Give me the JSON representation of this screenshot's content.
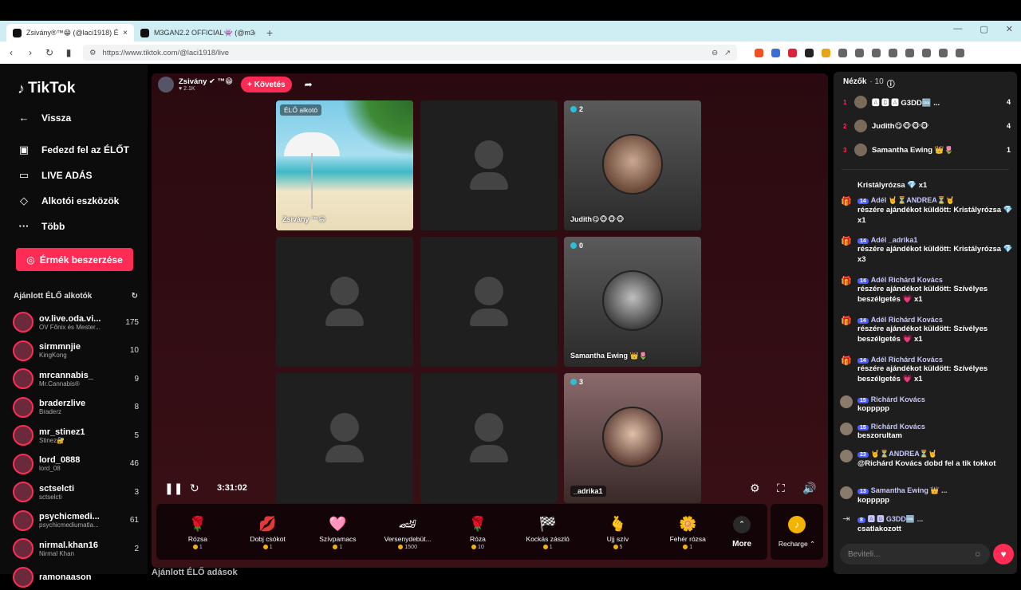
{
  "browser": {
    "tabs": [
      {
        "title": "Zsivány®™😁 (@laci1918) ÉL",
        "close": "×"
      },
      {
        "title": "M3GAN2.2 OFFICIAL👾 (@m3gan"
      }
    ],
    "new_tab": "+",
    "url": "https://www.tiktok.com/@laci1918/live"
  },
  "sidebar": {
    "logo": "TikTok",
    "items": [
      {
        "label": "Vissza",
        "icon": "back-arrow-icon"
      },
      {
        "label": "Fedezd fel az ÉLŐT",
        "icon": "live-explore-icon"
      },
      {
        "label": "LIVE ADÁS",
        "icon": "camera-icon"
      },
      {
        "label": "Alkotói eszközök",
        "icon": "creator-tools-icon"
      },
      {
        "label": "Több",
        "icon": "more-icon"
      }
    ],
    "coin_button": "Érmék beszerzése",
    "recommended_title": "Ajánlott ÉLŐ alkotók",
    "creators": [
      {
        "name": "ov.live.oda.vi...",
        "sub": "OV Főnix és Mester...",
        "count": "175"
      },
      {
        "name": "sirmmnjie",
        "sub": "KingKong",
        "count": "10"
      },
      {
        "name": "mrcannabis_",
        "sub": "Mr.Cannabis®",
        "count": "9"
      },
      {
        "name": "braderzlive",
        "sub": "Braderz",
        "count": "8"
      },
      {
        "name": "mr_stinez1",
        "sub": "Stinez🔐",
        "count": "5"
      },
      {
        "name": "lord_0888",
        "sub": "lord_08",
        "count": "46"
      },
      {
        "name": "sctselcti",
        "sub": "sctselcti",
        "count": "3"
      },
      {
        "name": "psychicmedi...",
        "sub": "psychicmediumatla...",
        "count": "61"
      },
      {
        "name": "nirmal.khan16",
        "sub": "Nirmal Khan",
        "count": "2"
      },
      {
        "name": "ramonaason",
        "sub": "",
        "count": ""
      }
    ]
  },
  "stage": {
    "host_name": "Zsivány",
    "host_suffix": "™😁",
    "host_likes": "♥ 2.1K",
    "follow_label": "+ Követés",
    "tiles": {
      "host_tag": "ÉLŐ alkotó",
      "host_label": "Zsivány ™😁",
      "judith_count": "2",
      "judith_label": "Judith😋🐵🐵🐵",
      "samantha_count": "0",
      "samantha_label": "Samantha Ewing 👑🌷",
      "adrika_count": "3",
      "adrika_label": "_adrika1"
    },
    "time": "3:31:02"
  },
  "gifts": [
    {
      "name": "Rózsa",
      "price": "1",
      "icon": "🌹"
    },
    {
      "name": "Dobj csókot",
      "price": "1",
      "icon": "💋"
    },
    {
      "name": "Szívpamacs",
      "price": "1",
      "icon": "🩷"
    },
    {
      "name": "Versenydebüt...",
      "price": "1500",
      "icon": "🏎"
    },
    {
      "name": "Róza",
      "price": "10",
      "icon": "🌹"
    },
    {
      "name": "Kockás zászló",
      "price": "1",
      "icon": "🏁"
    },
    {
      "name": "Ujj szív",
      "price": "5",
      "icon": "🫰"
    },
    {
      "name": "Fehér rózsa",
      "price": "1",
      "icon": "🌼"
    }
  ],
  "more_label": "More",
  "recharge_label": "Recharge ⌃",
  "bottom_heading": "Ajánlott ÉLŐ adások",
  "right_panel": {
    "viewers_title": "Nézők",
    "viewers_count": "· 10",
    "viewers": [
      {
        "rank": "1",
        "name": "🅰 🅱 🅰 G3DD🆒 ...",
        "score": "4"
      },
      {
        "rank": "2",
        "name": "Judith😋🐵🐵🐵",
        "score": "4"
      },
      {
        "rank": "3",
        "name": "Samantha Ewing 👑🌷",
        "score": "1"
      }
    ],
    "chat": [
      {
        "kind": "gift",
        "user": "",
        "badge": "",
        "msg": "Kristályrózsa 💎 x1"
      },
      {
        "kind": "gift",
        "user": "Adél 🤘⏳ANDREA⏳🤘",
        "badge": "14",
        "msg": "részére ajándékot küldött: Kristályrózsa 💎 x1"
      },
      {
        "kind": "gift",
        "user": "Adél _adrika1",
        "badge": "14",
        "msg": "részére ajándékot küldött: Kristályrózsa 💎 x3"
      },
      {
        "kind": "gift",
        "user": "Adél Richárd Kovács",
        "badge": "14",
        "msg": "részére ajándékot küldött: Szívélyes beszélgetés 💗 x1"
      },
      {
        "kind": "gift",
        "user": "Adél Richárd Kovács",
        "badge": "14",
        "msg": "részére ajándékot küldött: Szívélyes beszélgetés 💗 x1"
      },
      {
        "kind": "gift",
        "user": "Adél Richárd Kovács",
        "badge": "14",
        "msg": "részére ajándékot küldött: Szívélyes beszélgetés 💗 x1"
      },
      {
        "kind": "msg",
        "user": "Richárd Kovács",
        "badge": "15",
        "msg": "koppppp"
      },
      {
        "kind": "msg",
        "user": "Richárd Kovács",
        "badge": "15",
        "msg": "beszorultam"
      },
      {
        "kind": "msg",
        "user": "🤘⏳ANDREA⏳🤘",
        "badge": "23",
        "msg": "@Richárd Kovács dobd fel a tik tokkot"
      },
      {
        "kind": "msg",
        "user": "Samantha Ewing 👑 ...",
        "badge": "13",
        "msg": "koppppp"
      },
      {
        "kind": "join",
        "user": "🅰 🅱 G3DD🆒 ...",
        "badge": "8",
        "msg": "csatlakozott"
      }
    ],
    "input_placeholder": "Beviteli..."
  }
}
